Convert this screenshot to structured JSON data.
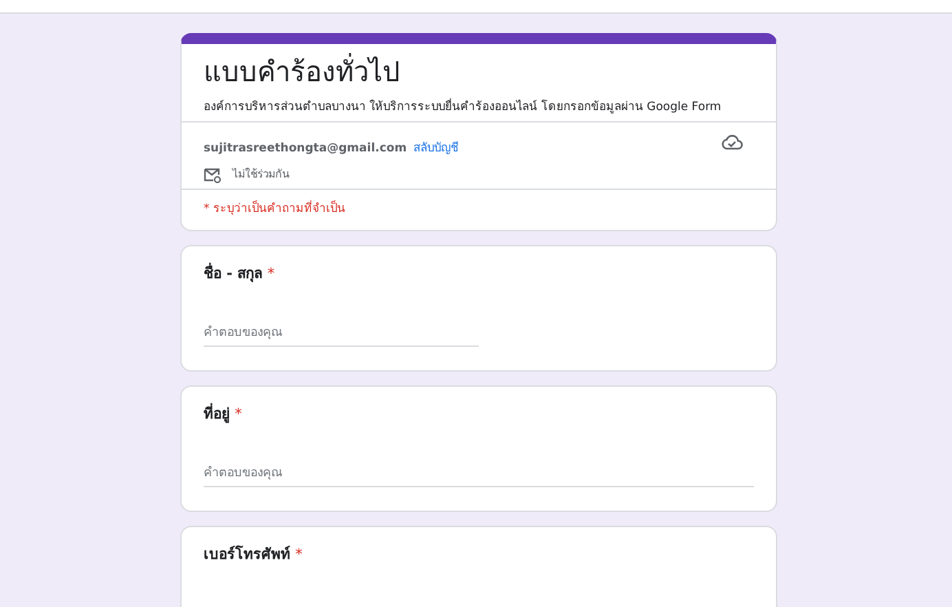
{
  "header": {
    "title": "แบบคำร้องทั่วไป",
    "description": "องค์การบริหารส่วนตำบลบางนา ให้บริการระบบยื่นคำร้องออนไลน์ โดยกรอกข้อมูลผ่าน Google Form",
    "account": {
      "email": "sujitrasreethongta@gmail.com",
      "switch_link": "สลับบัญชี",
      "sharing_note": "ไม่ใช้ร่วมกัน"
    },
    "required_note": "* ระบุว่าเป็นคำถามที่จำเป็น"
  },
  "questions": [
    {
      "label": "ชื่อ - สกุล",
      "required_mark": "*",
      "kind": "short",
      "placeholder": "คำตอบของคุณ"
    },
    {
      "label": "ที่อยู่",
      "required_mark": "*",
      "kind": "long",
      "placeholder": "คำตอบของคุณ"
    },
    {
      "label": "เบอร์โทรศัพท์",
      "required_mark": "*",
      "kind": "cut"
    }
  ]
}
